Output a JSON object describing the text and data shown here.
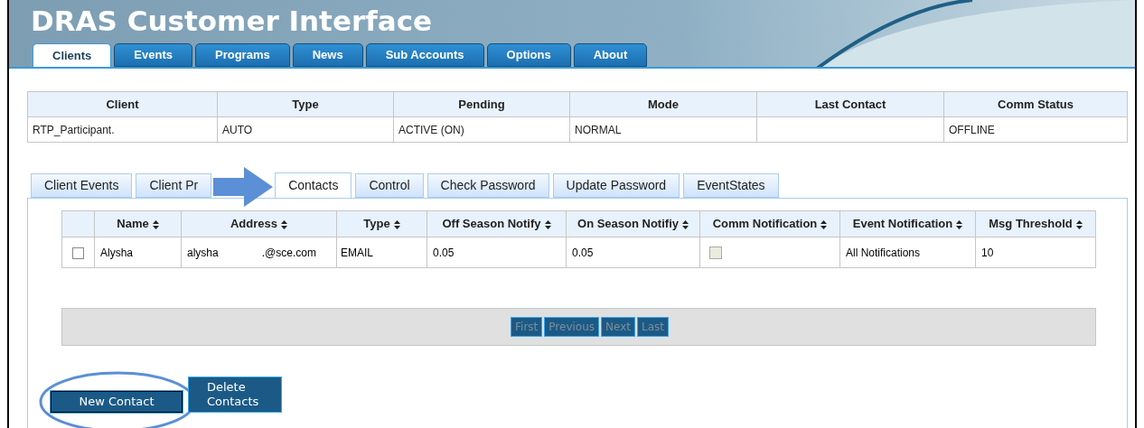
{
  "header": {
    "title": "DRAS Customer Interface"
  },
  "main_tabs": [
    {
      "label": "Clients",
      "selected": true
    },
    {
      "label": "Events",
      "selected": false
    },
    {
      "label": "Programs",
      "selected": false
    },
    {
      "label": "News",
      "selected": false
    },
    {
      "label": "Sub Accounts",
      "selected": false
    },
    {
      "label": "Options",
      "selected": false
    },
    {
      "label": "About",
      "selected": false
    }
  ],
  "client_table": {
    "columns": [
      "Client",
      "Type",
      "Pending",
      "Mode",
      "Last Contact",
      "Comm Status"
    ],
    "rows": [
      [
        "RTP_Participant.",
        "AUTO",
        "ACTIVE (ON)",
        "NORMAL",
        "",
        "OFFLINE"
      ]
    ]
  },
  "sub_tabs": [
    {
      "label": "Client Events",
      "selected": false
    },
    {
      "label": "Client Pr",
      "selected": false
    },
    {
      "label": "Contacts",
      "selected": true
    },
    {
      "label": "Control",
      "selected": false
    },
    {
      "label": "Check Password",
      "selected": false
    },
    {
      "label": "Update Password",
      "selected": false
    },
    {
      "label": "EventStates",
      "selected": false
    }
  ],
  "contacts_table": {
    "columns": [
      "Name",
      "Address",
      "Type",
      "Off Season Notify",
      "On Season Notifiy",
      "Comm Notification",
      "Event Notification",
      "Msg Threshold"
    ],
    "rows": [
      {
        "checked": false,
        "name": "Alysha",
        "address_start": "alysha",
        "address_end": ".@sce.com",
        "type": "EMAIL",
        "off_season": "0.05",
        "on_season": "0.05",
        "comm_notification": false,
        "event_notification": "All Notifications",
        "msg_threshold": "10"
      }
    ]
  },
  "pager": [
    {
      "label": "First",
      "disabled": true
    },
    {
      "label": "Previous",
      "disabled": true
    },
    {
      "label": "Next",
      "disabled": true
    },
    {
      "label": "Last",
      "disabled": true
    }
  ],
  "buttons": [
    {
      "label": "New Contact",
      "highlighted": true
    },
    {
      "label": "Delete Contacts",
      "highlighted": false
    }
  ]
}
